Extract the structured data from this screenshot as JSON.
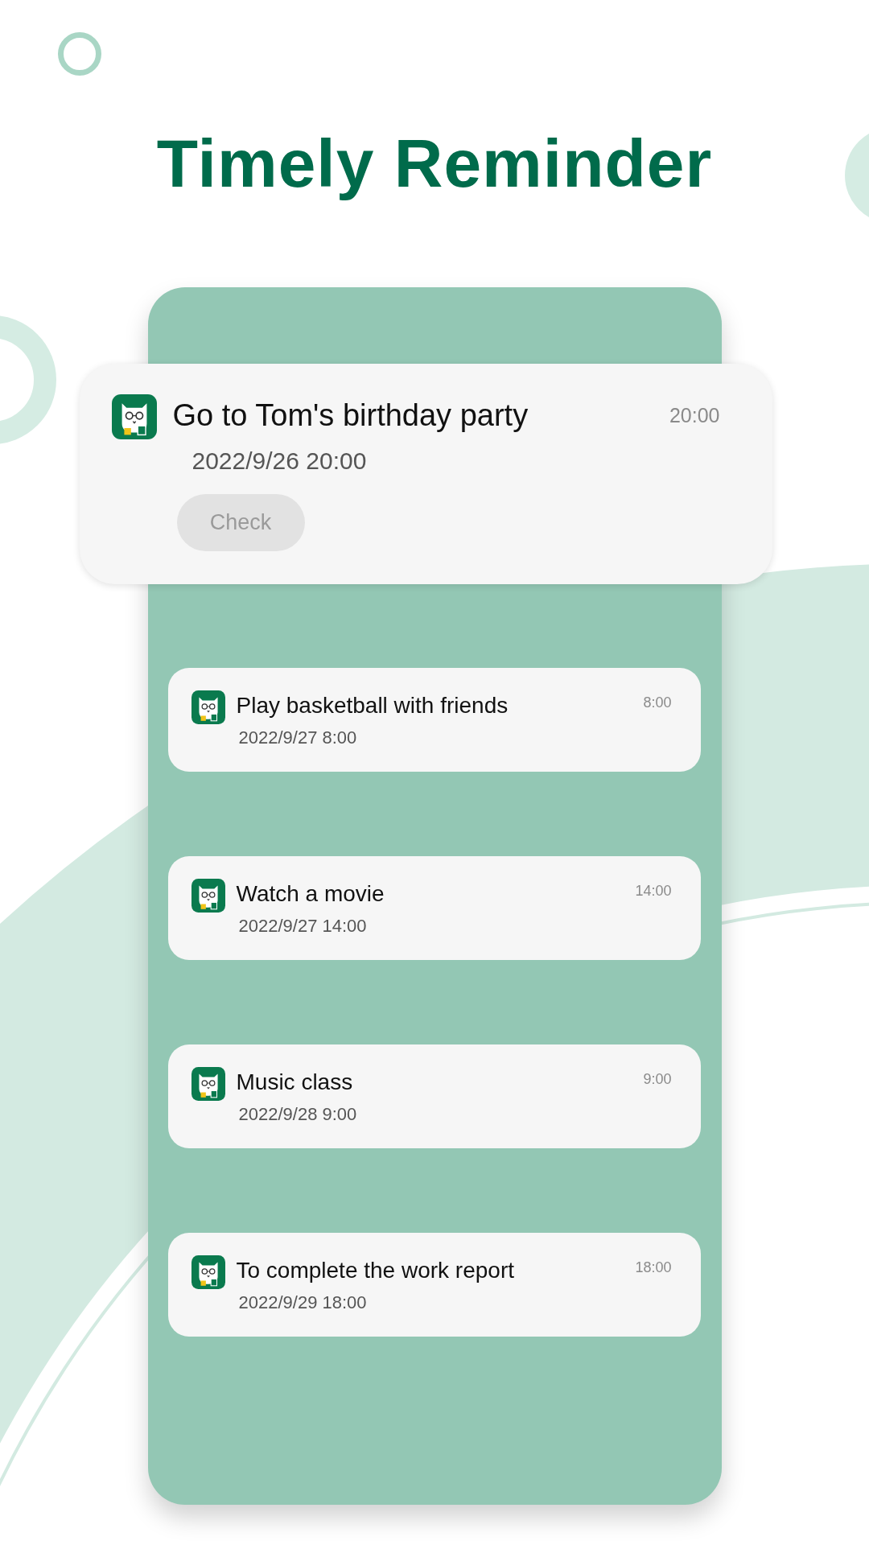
{
  "title": "Timely Reminder",
  "featured": {
    "title": "Go to Tom's birthday party",
    "time": "20:00",
    "date": "2022/9/26 20:00",
    "button": "Check"
  },
  "notifications": [
    {
      "title": "Play basketball with friends",
      "time": "8:00",
      "date": "2022/9/27 8:00"
    },
    {
      "title": "Watch a movie",
      "time": "14:00",
      "date": "2022/9/27 14:00"
    },
    {
      "title": "Music class",
      "time": "9:00",
      "date": "2022/9/28 9:00"
    },
    {
      "title": "To complete the work report",
      "time": "18:00",
      "date": "2022/9/29 18:00"
    }
  ]
}
